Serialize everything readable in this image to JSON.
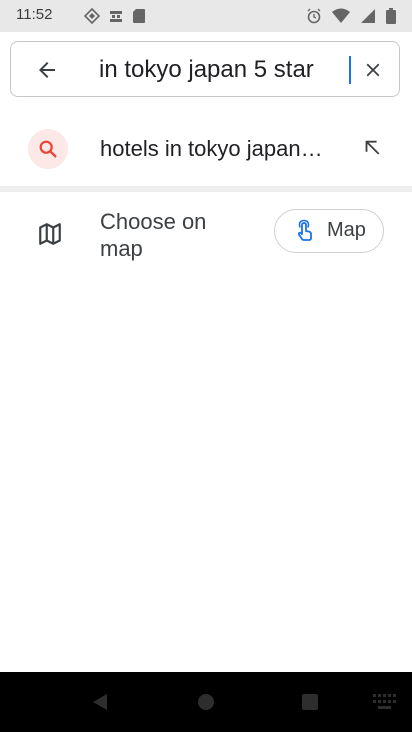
{
  "status_bar": {
    "time": "11:52",
    "left_icons": [
      "notification-diamond-icon",
      "notification-usb-icon",
      "sd-card-icon"
    ],
    "right_icons": [
      "alarm-icon",
      "wifi-icon",
      "signal-icon",
      "battery-icon"
    ]
  },
  "search": {
    "query": "in tokyo japan 5 star",
    "back_icon": "arrow-back-icon",
    "clear_icon": "close-icon"
  },
  "suggestions": [
    {
      "label": "hotels in tokyo japan…",
      "icon": "search-icon",
      "action_icon": "arrow-fill-in-icon"
    }
  ],
  "choose_on_map": {
    "label": "Choose on map",
    "icon": "map-icon",
    "button_label": "Map",
    "button_icon": "touch-gesture-icon"
  },
  "nav_bar": {
    "buttons": [
      "back-triangle-icon",
      "home-circle-icon",
      "recents-square-icon",
      "keyboard-icon"
    ]
  },
  "colors": {
    "status_bar_bg": "#e8e8e8",
    "accent_red": "#ea4335",
    "suggestion_icon_bg": "#fce8e6",
    "cursor_blue": "#1a73e8",
    "nav_bar_bg": "#000000"
  }
}
